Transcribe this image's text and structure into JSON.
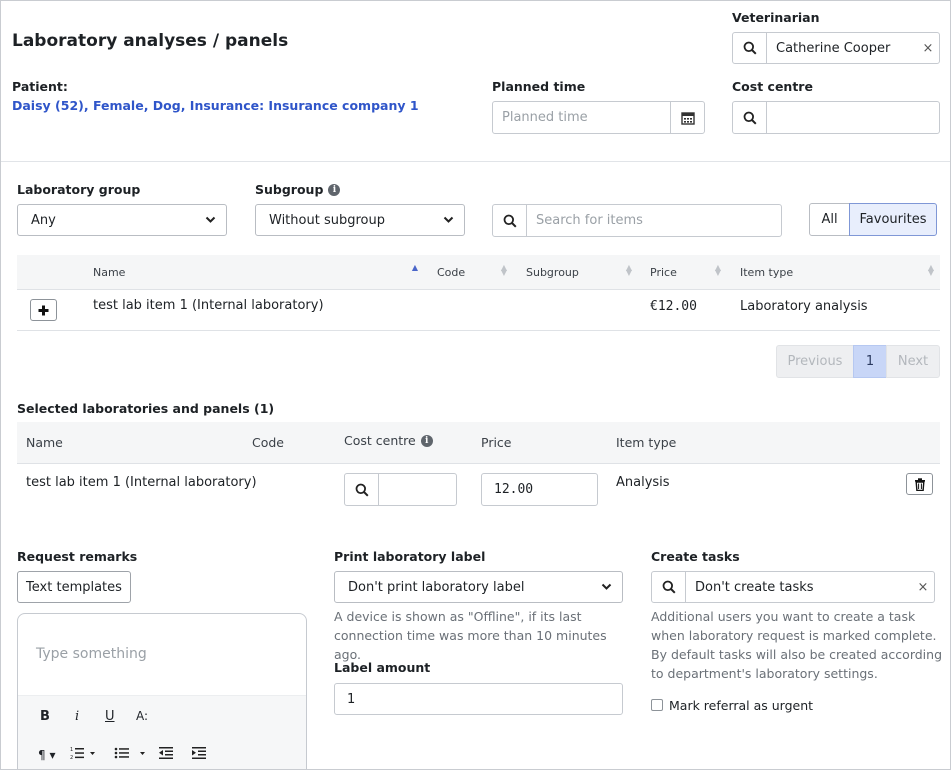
{
  "header": {
    "title": "Laboratory analyses / panels",
    "veterinarian_label": "Veterinarian",
    "veterinarian_value": "Catherine Cooper",
    "patient_label": "Patient:",
    "patient_value": "Daisy (52), Female, Dog, Insurance: Insurance company 1",
    "planned_time_label": "Planned time",
    "planned_time_placeholder": "Planned time",
    "cost_centre_label": "Cost centre",
    "cost_centre_value": ""
  },
  "filters": {
    "lab_group_label": "Laboratory group",
    "lab_group_value": "Any",
    "subgroup_label": "Subgroup",
    "subgroup_value": "Without subgroup",
    "search_placeholder": "Search for items",
    "all_label": "All",
    "favourites_label": "Favourites"
  },
  "items_table": {
    "columns": [
      "Name",
      "Code",
      "Subgroup",
      "Price",
      "Item type"
    ],
    "rows": [
      {
        "name": "test lab item 1 (Internal laboratory)",
        "code": "",
        "subgroup": "",
        "price": "€12.00",
        "item_type": "Laboratory analysis"
      }
    ],
    "pagination": {
      "previous": "Previous",
      "page": "1",
      "next": "Next"
    }
  },
  "selected": {
    "title": "Selected laboratories and panels (1)",
    "columns": [
      "Name",
      "Code",
      "Cost centre",
      "Price",
      "Item type"
    ],
    "rows": [
      {
        "name": "test lab item 1 (Internal laboratory)",
        "code": "",
        "cost_centre": "",
        "price": "12.00",
        "item_type": "Analysis"
      }
    ]
  },
  "remarks": {
    "label": "Request remarks",
    "templates_button": "Text templates",
    "placeholder": "Type something",
    "toolbar": [
      "B",
      "i",
      "U",
      "A:"
    ]
  },
  "print_label": {
    "label": "Print laboratory label",
    "value": "Don't print laboratory label",
    "help": "A device is shown as \"Offline\", if its last connection time was more than 10 minutes ago.",
    "amount_label": "Label amount",
    "amount_value": "1"
  },
  "tasks": {
    "label": "Create tasks",
    "value": "Don't create tasks",
    "help": "Additional users you want to create a task when laboratory request is marked complete. By default tasks will also be created according to department's laboratory settings.",
    "urgent_label": "Mark referral as urgent",
    "urgent_checked": false
  },
  "colors": {
    "accent": "#2f55c9",
    "active_page": "#c8d6f7",
    "favourites_bg": "#e8eefc"
  }
}
